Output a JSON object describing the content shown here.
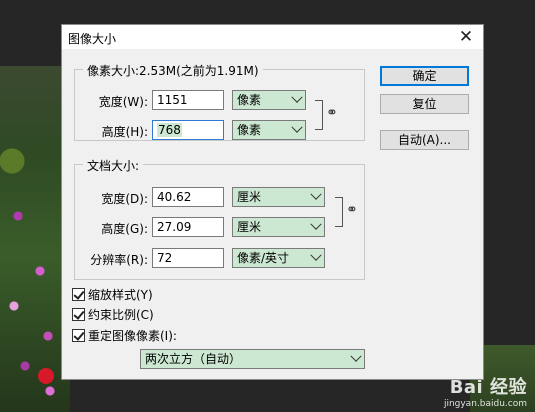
{
  "dialog": {
    "title": "图像大小",
    "close_glyph": "✕"
  },
  "pixel_dimensions": {
    "legend": "像素大小:2.53M(之前为1.91M)",
    "width_label": "宽度(W):",
    "width_value": "1151",
    "width_unit": "像素",
    "height_label": "高度(H):",
    "height_value": "768",
    "height_unit": "像素"
  },
  "document_size": {
    "legend": "文档大小:",
    "width_label": "宽度(D):",
    "width_value": "40.62",
    "width_unit": "厘米",
    "height_label": "高度(G):",
    "height_value": "27.09",
    "height_unit": "厘米",
    "resolution_label": "分辨率(R):",
    "resolution_value": "72",
    "resolution_unit": "像素/英寸"
  },
  "buttons": {
    "ok": "确定",
    "reset": "复位",
    "auto": "自动(A)..."
  },
  "options": {
    "scale_styles": {
      "label": "缩放样式(Y)",
      "checked": true
    },
    "constrain_proportions": {
      "label": "约束比例(C)",
      "checked": true
    },
    "resample_image": {
      "label": "重定图像像素(I):",
      "checked": true
    },
    "resample_method": "两次立方（自动）"
  },
  "watermark": {
    "logo": "Bai 经验",
    "url": "jingyan.baidu.com"
  },
  "colors": {
    "select_fill": "#cde8d2",
    "default_button_border": "#0078d7"
  }
}
